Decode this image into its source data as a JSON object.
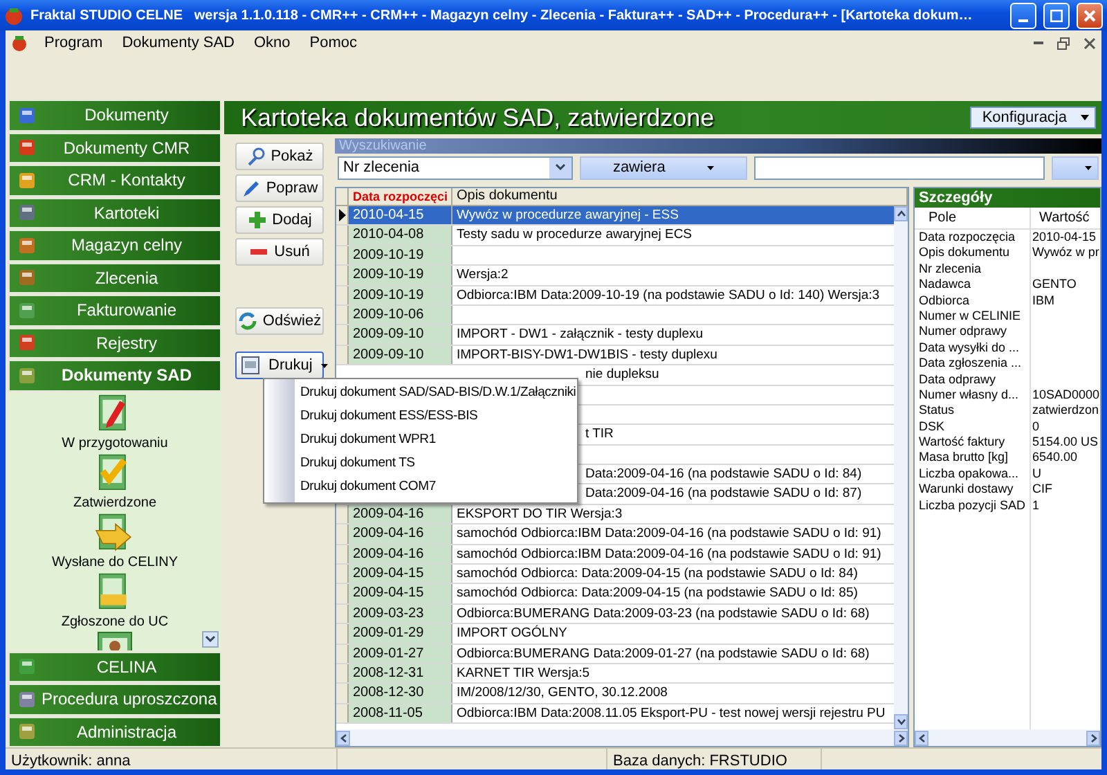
{
  "window": {
    "title": "Fraktal STUDIO CELNE   wersja 1.1.0.118 - CMR++ - CRM++ - Magazyn celny - Zlecenia - Faktura++ - SAD++ - Procedura++ - [Kartoteka dokum…"
  },
  "menu": [
    "Program",
    "Dokumenty SAD",
    "Okno",
    "Pomoc"
  ],
  "sidebar": {
    "items": [
      {
        "label": "Dokumenty",
        "selected": false
      },
      {
        "label": "Dokumenty CMR",
        "selected": false
      },
      {
        "label": "CRM - Kontakty",
        "selected": false
      },
      {
        "label": "Kartoteki",
        "selected": false
      },
      {
        "label": "Magazyn celny",
        "selected": false
      },
      {
        "label": "Zlecenia",
        "selected": false
      },
      {
        "label": "Fakturowanie",
        "selected": false
      },
      {
        "label": "Rejestry",
        "selected": false
      },
      {
        "label": "Dokumenty SAD",
        "selected": true
      },
      {
        "label": "CELINA",
        "selected": false
      },
      {
        "label": "Procedura uproszczona",
        "selected": false
      },
      {
        "label": "Administracja",
        "selected": false
      }
    ],
    "sub_items": [
      {
        "label": "W przygotowaniu",
        "kind": "edit"
      },
      {
        "label": "Zatwierdzone",
        "kind": "approved"
      },
      {
        "label": "Wysłane do CELINY",
        "kind": "sent"
      },
      {
        "label": "Zgłoszone do UC",
        "kind": "declared"
      }
    ]
  },
  "header": {
    "title": "Kartoteka dokumentów SAD, zatwierdzone",
    "config_button": "Konfiguracja"
  },
  "actions": [
    {
      "label": "Pokaż",
      "kind": "view"
    },
    {
      "label": "Popraw",
      "kind": "edit"
    },
    {
      "label": "Dodaj",
      "kind": "add"
    },
    {
      "label": "Usuń",
      "kind": "remove"
    },
    {
      "label": "Odśwież",
      "kind": "refresh"
    }
  ],
  "print": {
    "label": "Drukuj",
    "menu": [
      "Drukuj dokument SAD/SAD-BIS/D.W.1/Załączniki",
      "Drukuj dokument ESS/ESS-BIS",
      "Drukuj dokument WPR1",
      "Drukuj dokument TS",
      "Drukuj dokument COM7"
    ]
  },
  "search": {
    "title": "Wyszukiwanie",
    "field": "Nr zlecenia",
    "operator": "zawiera"
  },
  "table": {
    "columns": [
      {
        "label": "Data rozpoczęci",
        "sorted": true
      },
      {
        "label": "Opis dokumentu",
        "sorted": false
      }
    ],
    "rows": [
      {
        "date": "2010-04-15",
        "description": "Wywóz w procedurze awaryjnej - ESS",
        "selected": true
      },
      {
        "date": "2010-04-08",
        "description": "Testy sadu w procedurze awaryjnej ECS",
        "selected": false
      },
      {
        "date": "2009-10-19",
        "selected": false
      },
      {
        "date": "2009-10-19",
        "description": "Wersja:2",
        "selected": false
      },
      {
        "date": "2009-10-19",
        "description": "Odbiorca:IBM Data:2009-10-19 (na podstawie SADU o Id: 140) Wersja:3",
        "selected": false
      },
      {
        "date": "2009-10-06",
        "selected": false
      },
      {
        "date": "2009-09-10",
        "description": "IMPORT - DW1 - załącznik - testy duplexu",
        "selected": false
      },
      {
        "date": "2009-09-10",
        "description": "IMPORT-BISY-DW1-DW1BIS - testy duplexu",
        "selected": false
      },
      {
        "description": "nie dupleksu"
      },
      {},
      {},
      {
        "description": "t TIR"
      },
      {},
      {
        "description": "Data:2009-04-16 (na podstawie SADU o Id: 84)"
      },
      {
        "description": "Data:2009-04-16 (na podstawie SADU o Id: 87)"
      },
      {
        "date": "2009-04-16",
        "description": "EKSPORT DO TIR Wersja:3",
        "selected": false
      },
      {
        "date": "2009-04-16",
        "description": "samochód Odbiorca:IBM Data:2009-04-16 (na podstawie SADU o Id: 91)",
        "selected": false
      },
      {
        "date": "2009-04-16",
        "description": "samochód Odbiorca:IBM Data:2009-04-16 (na podstawie SADU o Id: 91)",
        "selected": false
      },
      {
        "date": "2009-04-15",
        "description": "samochód Odbiorca: Data:2009-04-15 (na podstawie SADU o Id: 84)",
        "selected": false
      },
      {
        "date": "2009-04-15",
        "description": "samochód Odbiorca: Data:2009-04-15 (na podstawie SADU o Id: 85)",
        "selected": false
      },
      {
        "date": "2009-03-23",
        "description": "Odbiorca:BUMERANG Data:2009-03-23 (na podstawie SADU o Id: 68)",
        "selected": false
      },
      {
        "date": "2009-01-29",
        "description": "IMPORT OGÓLNY",
        "selected": false
      },
      {
        "date": "2009-01-27",
        "description": "Odbiorca:BUMERANG Data:2009-01-27 (na podstawie SADU o Id: 68)",
        "selected": false
      },
      {
        "date": "2008-12-31",
        "description": "KARNET TIR Wersja:5",
        "selected": false
      },
      {
        "date": "2008-12-30",
        "description": "IM/2008/12/30, GENTO, 30.12.2008",
        "selected": false
      },
      {
        "date": "2008-11-05",
        "description": "Odbiorca:IBM Data:2008.11.05 Eksport-PU - test nowej wersji rejestru PU",
        "selected": false
      }
    ]
  },
  "details": {
    "title": "Szczegóły",
    "columns": [
      "Pole",
      "Wartość"
    ],
    "rows": [
      {
        "field": "Data rozpoczęcia",
        "value": "2010-04-15"
      },
      {
        "field": "Opis dokumentu",
        "value": "Wywóz w pr"
      },
      {
        "field": "Nr zlecenia"
      },
      {
        "field": "Nadawca",
        "value": "GENTO"
      },
      {
        "field": "Odbiorca",
        "value": "IBM"
      },
      {
        "field": "Numer w CELINIE"
      },
      {
        "field": "Numer odprawy"
      },
      {
        "field": "Data wysyłki do ..."
      },
      {
        "field": "Data zgłoszenia ..."
      },
      {
        "field": "Data odprawy"
      },
      {
        "field": "Numer własny d...",
        "value": "10SAD0000"
      },
      {
        "field": "Status",
        "value": "zatwierdzon"
      },
      {
        "field": "DSK",
        "value": "0"
      },
      {
        "field": "Wartość faktury",
        "value": "5154.00 US"
      },
      {
        "field": "Masa brutto [kg]",
        "value": "6540.00"
      },
      {
        "field": "Liczba opakowa...",
        "value": "U"
      },
      {
        "field": "Warunki dostawy",
        "value": "CIF"
      },
      {
        "field": "Liczba pozycji SAD",
        "value": "1"
      }
    ]
  },
  "status_bar": [
    "Użytkownik: anna",
    "Baza danych: FRSTUDIO"
  ]
}
